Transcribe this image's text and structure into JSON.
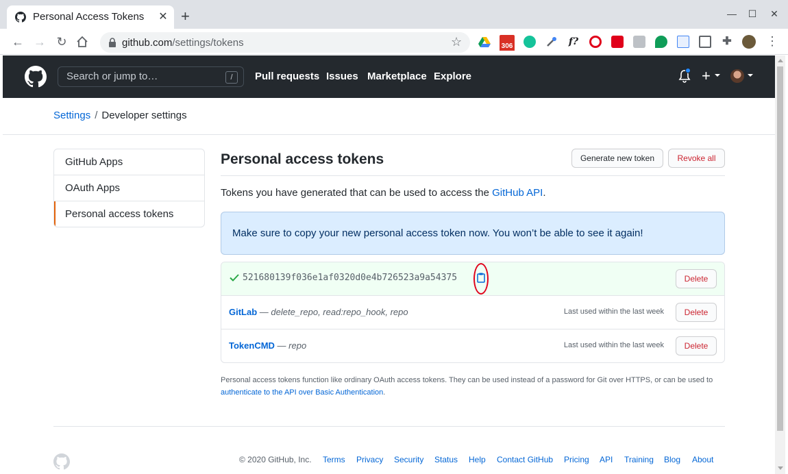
{
  "browser": {
    "tab_title": "Personal Access Tokens",
    "url_host": "github.com",
    "url_path": "/settings/tokens",
    "ext_badge": "306"
  },
  "header": {
    "search_placeholder": "Search or jump to…",
    "search_key": "/",
    "nav": [
      "Pull requests",
      "Issues",
      "Marketplace",
      "Explore"
    ]
  },
  "breadcrumb": {
    "parent": "Settings",
    "sep": "/",
    "current": "Developer settings"
  },
  "sidebar": {
    "items": [
      {
        "label": "GitHub Apps"
      },
      {
        "label": "OAuth Apps"
      },
      {
        "label": "Personal access tokens"
      }
    ]
  },
  "main": {
    "title": "Personal access tokens",
    "generate_label": "Generate new token",
    "revoke_label": "Revoke all",
    "desc_prefix": "Tokens you have generated that can be used to access the ",
    "desc_link": "GitHub API",
    "desc_suffix": ".",
    "flash": "Make sure to copy your new personal access token now. You won’t be able to see it again!",
    "new_token": "521680139f036e1af0320d0e4b726523a9a54375",
    "delete_label": "Delete",
    "tokens": [
      {
        "name": "GitLab",
        "dash": " — ",
        "scopes": "delete_repo, read:repo_hook, repo",
        "last_used": "Last used within the last week"
      },
      {
        "name": "TokenCMD",
        "dash": " — ",
        "scopes": "repo",
        "last_used": "Last used within the last week"
      }
    ],
    "note_text": "Personal access tokens function like ordinary OAuth access tokens. They can be used instead of a password for Git over HTTPS, or can be used to ",
    "note_link": "authenticate to the API over Basic Authentication",
    "note_end": "."
  },
  "footer": {
    "copyright": "© 2020 GitHub, Inc.",
    "links": [
      "Terms",
      "Privacy",
      "Security",
      "Status",
      "Help",
      "Contact GitHub",
      "Pricing",
      "API",
      "Training",
      "Blog",
      "About"
    ]
  },
  "colors": {
    "link": "#0366d6",
    "danger": "#cb2431",
    "header_bg": "#24292e",
    "flash_bg": "#dbedff",
    "new_token_bg": "#f0fff4",
    "highlight": "#e0001a"
  }
}
